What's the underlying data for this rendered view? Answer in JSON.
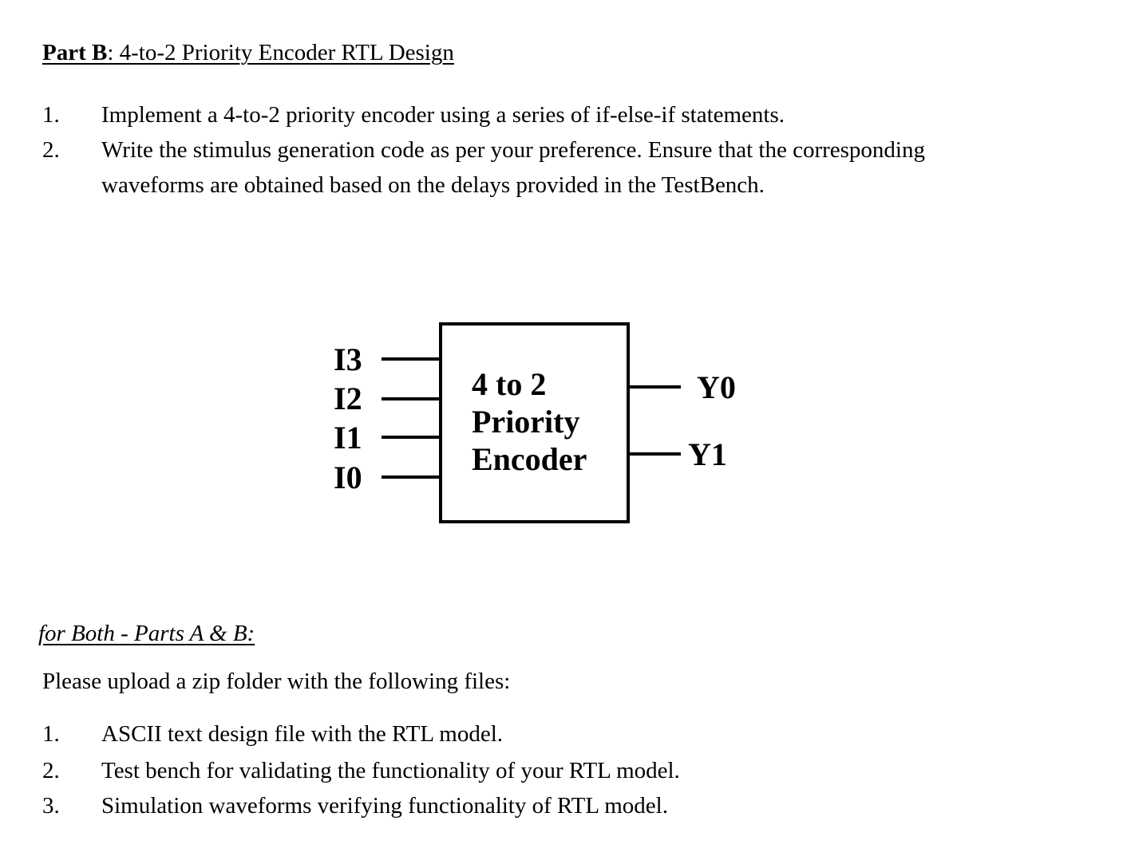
{
  "heading": {
    "bold_part": "Part B",
    "rest": ": 4-to-2 Priority Encoder RTL Design"
  },
  "tasks": [
    {
      "num": "1.",
      "lines": [
        "Implement a 4-to-2 priority encoder using a series of if-else-if statements."
      ]
    },
    {
      "num": "2.",
      "lines": [
        "Write the stimulus generation code as per your preference. Ensure that the corresponding",
        "waveforms are obtained based on the delays provided in the TestBench."
      ]
    }
  ],
  "diagram": {
    "block_lines": [
      "4 to 2",
      "Priority",
      "Encoder"
    ],
    "inputs": [
      "I3",
      "I2",
      "I1",
      "I0"
    ],
    "outputs": [
      "Y0",
      "Y1"
    ]
  },
  "subheading": "for Both - Parts A & B:",
  "instruction": "Please upload a zip folder with the following files:",
  "files": [
    {
      "num": "1.",
      "text": "ASCII text design file with the RTL model."
    },
    {
      "num": "2.",
      "text": "Test bench for validating the functionality of your RTL model."
    },
    {
      "num": "3.",
      "text": "Simulation waveforms verifying functionality of RTL model."
    }
  ]
}
